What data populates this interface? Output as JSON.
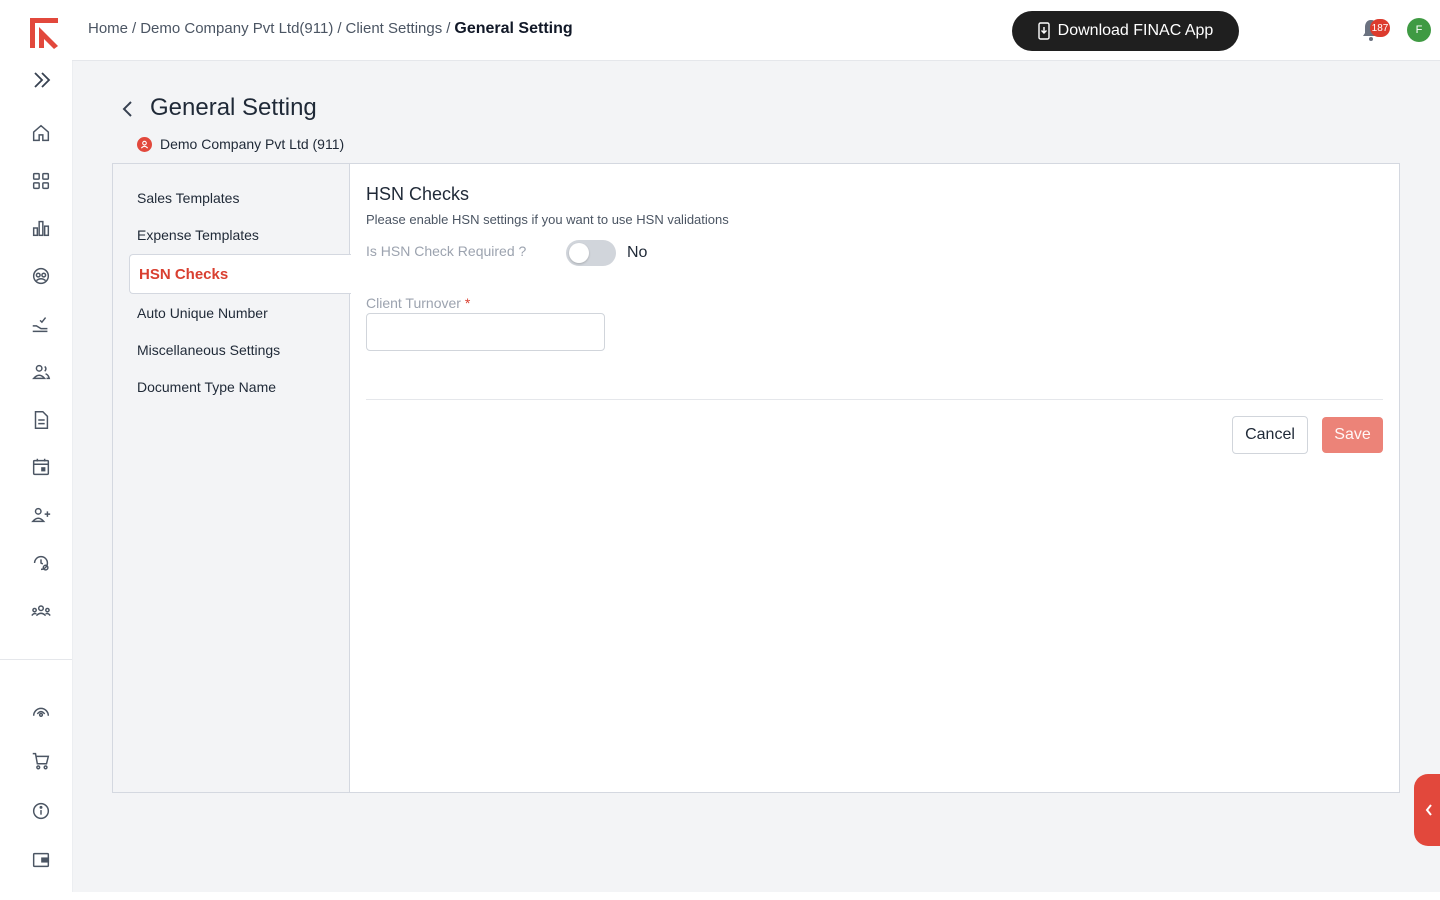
{
  "header": {
    "breadcrumb": [
      {
        "label": "Home"
      },
      {
        "label": "Demo Company Pvt Ltd(911)"
      },
      {
        "label": "Client Settings"
      }
    ],
    "breadcrumb_current": "General Setting",
    "download_label": "Download FINAC App",
    "notification_count": "187",
    "avatar_initial": "F"
  },
  "page": {
    "title": "General Setting",
    "company": "Demo Company Pvt Ltd (911)"
  },
  "settings_menu": [
    {
      "label": "Sales Templates"
    },
    {
      "label": "Expense Templates"
    },
    {
      "label": "HSN Checks",
      "active": true
    },
    {
      "label": "Auto Unique Number"
    },
    {
      "label": "Miscellaneous Settings"
    },
    {
      "label": "Document Type Name"
    }
  ],
  "hsn": {
    "title": "HSN Checks",
    "description": "Please enable HSN settings if you want to use HSN validations",
    "check_label": "Is HSN Check Required ?",
    "check_value": "No",
    "turnover_label": "Client Turnover",
    "turnover_required": "*",
    "turnover_value": ""
  },
  "actions": {
    "cancel": "Cancel",
    "save": "Save"
  },
  "colors": {
    "accent": "#d93f30",
    "save_disabled": "#ec8378",
    "dark_button": "#1f1f1f"
  },
  "sidebar_icons": [
    "logo-icon",
    "expand-icon",
    "home-icon",
    "dashboard-grid-icon",
    "bar-chart-icon",
    "contacts-icon",
    "hand-check-icon",
    "users-icon",
    "document-icon",
    "calendar-icon",
    "user-add-icon",
    "history-settings-icon",
    "team-icon",
    "support-icon",
    "cart-icon",
    "info-icon",
    "wallet-icon"
  ]
}
